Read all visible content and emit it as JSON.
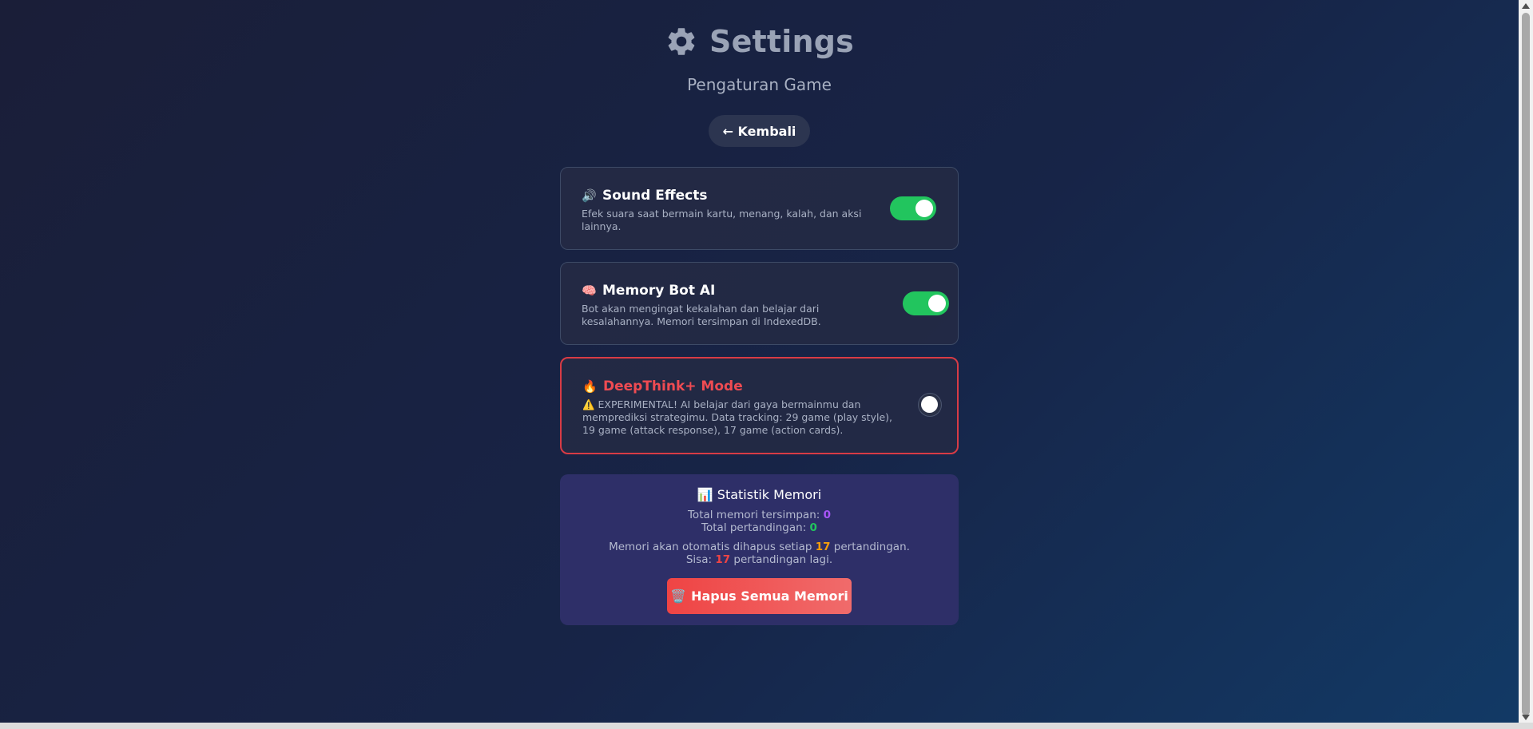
{
  "header": {
    "title": "Settings",
    "subtitle": "Pengaturan Game",
    "back_label": "← Kembali"
  },
  "settings": [
    {
      "emoji": "🔊",
      "title": "Sound Effects",
      "description": "Efek suara saat bermain kartu, menang, kalah, dan aksi lainnya.",
      "enabled": true
    },
    {
      "emoji": "🧠",
      "title": "Memory Bot AI",
      "description": "Bot akan mengingat kekalahan dan belajar dari kesalahannya. Memori tersimpan di IndexedDB.",
      "enabled": true
    },
    {
      "emoji": "🔥",
      "title": "DeepThink+ Mode",
      "description": "⚠️ EXPERIMENTAL! AI belajar dari gaya bermainmu dan memprediksi strategimu. Data tracking: 29 game (play style), 19 game (attack response), 17 game (action cards).",
      "enabled": false
    }
  ],
  "stats": {
    "title": "📊 Statistik Memori",
    "total_memory_label": "Total memori tersimpan: ",
    "total_memory_value": "0",
    "total_matches_label": "Total pertandingan: ",
    "total_matches_value": "0",
    "auto_delete_prefix": "Memori akan otomatis dihapus setiap ",
    "auto_delete_value": "17",
    "auto_delete_suffix": " pertandingan.",
    "remaining_prefix": "Sisa: ",
    "remaining_value": "17",
    "remaining_suffix": " pertandingan lagi.",
    "delete_button_emoji": "🗑️",
    "delete_button_label": "Hapus Semua Memori"
  },
  "colors": {
    "toggle_on": "#22c55e",
    "danger": "#ef4b52",
    "stats_bg": "#2e2f68"
  },
  "icons": {
    "title_icon": "gear-icon"
  }
}
